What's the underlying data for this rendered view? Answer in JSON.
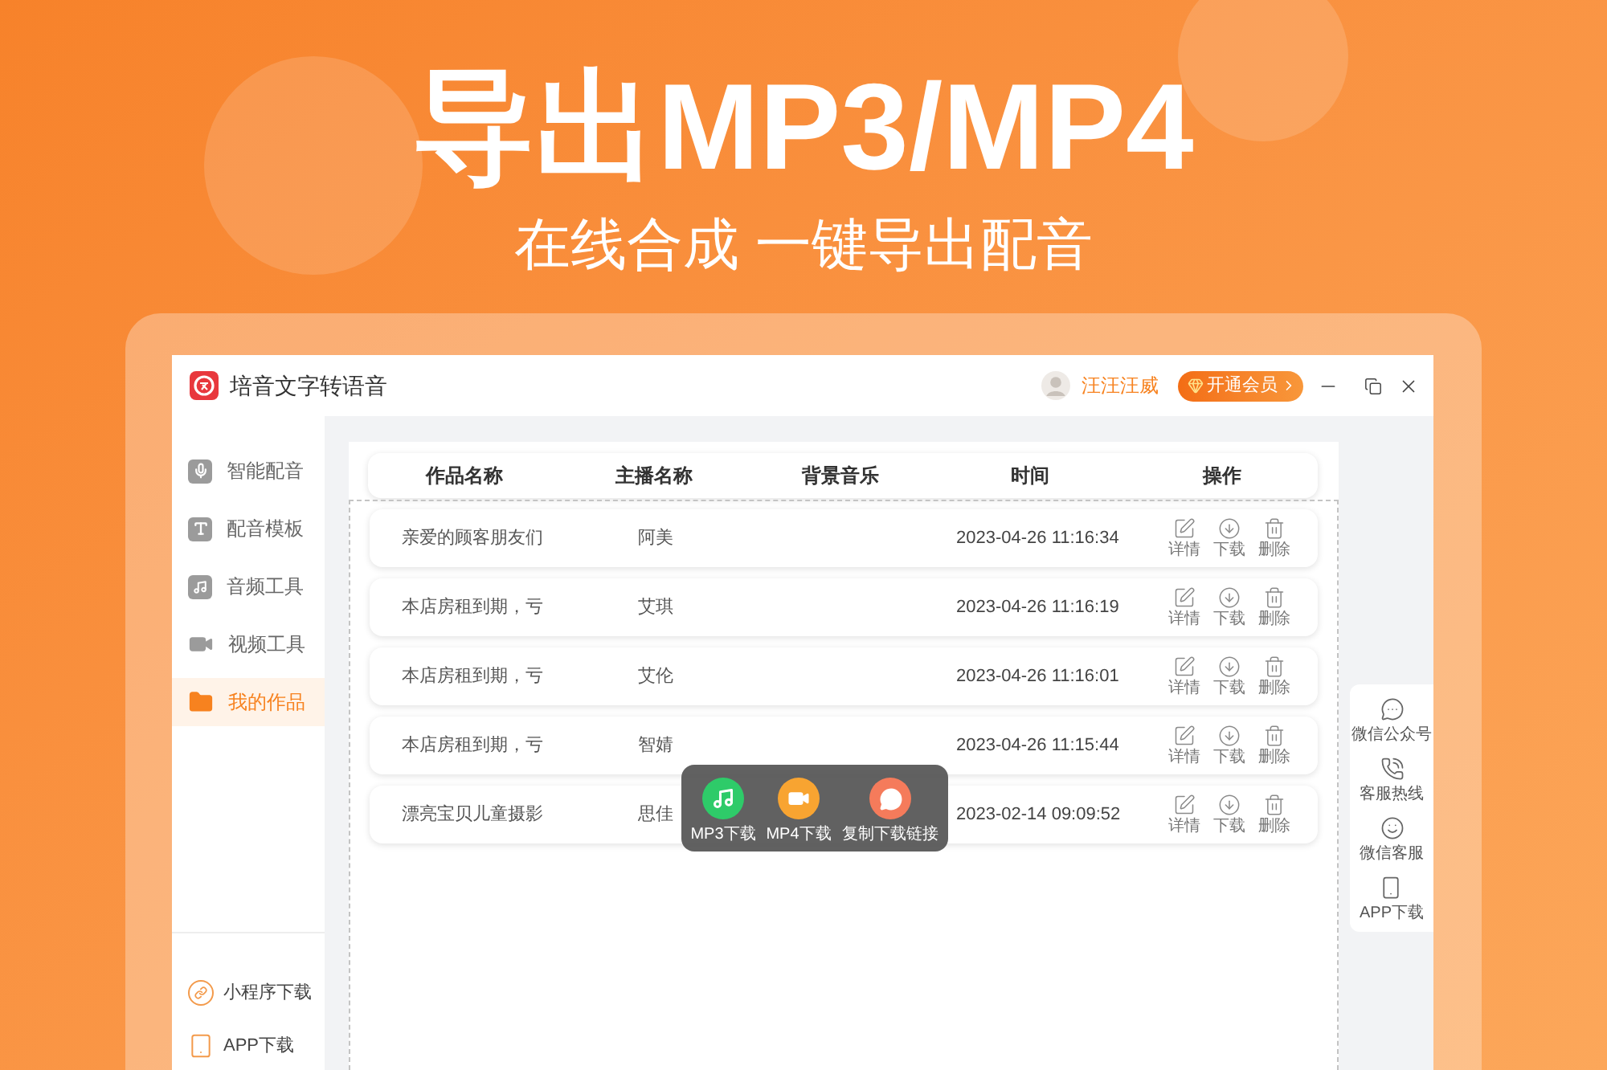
{
  "banner": {
    "title": "导出MP3/MP4",
    "subtitle": "在线合成 一键导出配音"
  },
  "window": {
    "title": "培音文字转语音",
    "user_name": "汪汪汪威",
    "vip_button": "开通会员"
  },
  "sidebar": {
    "items": [
      {
        "label": "智能配音",
        "selected": false
      },
      {
        "label": "配音模板",
        "selected": false
      },
      {
        "label": "音频工具",
        "selected": false
      },
      {
        "label": "视频工具",
        "selected": false
      },
      {
        "label": "我的作品",
        "selected": true
      }
    ],
    "bottom_links": [
      "小程序下载",
      "APP下载"
    ]
  },
  "table": {
    "columns": [
      "作品名称",
      "主播名称",
      "背景音乐",
      "时间",
      "操作"
    ],
    "rows": [
      {
        "name": "亲爱的顾客朋友们",
        "anchor": "阿美",
        "time": "2023-04-26 11:16:34",
        "actions": [
          "详情",
          "下载",
          "删除"
        ]
      },
      {
        "name": "本店房租到期，亏",
        "anchor": "艾琪",
        "time": "2023-04-26 11:16:19",
        "actions": [
          "详情",
          "下载",
          "删除"
        ]
      },
      {
        "name": "本店房租到期，亏",
        "anchor": "艾伦",
        "time": "2023-04-26 11:16:01",
        "actions": [
          "详情",
          "下载",
          "删除"
        ]
      },
      {
        "name": "本店房租到期，亏",
        "anchor": "智婧",
        "time": "2023-04-26 11:15:44",
        "actions": [
          "详情",
          "下载",
          "删除"
        ]
      },
      {
        "name": "漂亮宝贝儿童摄影",
        "anchor": "思佳",
        "time": "2023-02-14 09:09:52",
        "actions": [
          "详情",
          "下载",
          "删除"
        ]
      }
    ]
  },
  "download_popup": {
    "items": [
      "MP3下载",
      "MP4下载",
      "复制下载链接"
    ]
  },
  "side_panel": {
    "items": [
      "微信公众号",
      "客服热线",
      "微信客服",
      "APP下载"
    ]
  }
}
